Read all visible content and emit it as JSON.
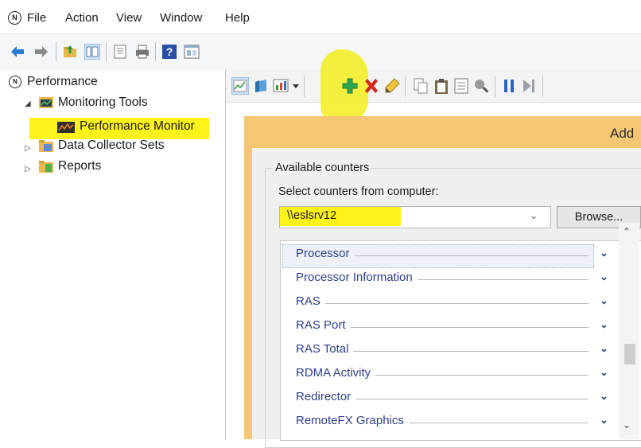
{
  "menubar": {
    "items": [
      "File",
      "Action",
      "View",
      "Window",
      "Help"
    ]
  },
  "toolbar": {
    "icons": [
      "back-arrow-icon",
      "forward-arrow-icon",
      "up-folder-icon",
      "show-hide-tree-icon",
      "properties-icon",
      "print-icon",
      "help-icon",
      "mmc-panel-icon"
    ]
  },
  "tree": {
    "root": "Performance",
    "items": [
      {
        "label": "Monitoring Tools",
        "level": 1,
        "expanded": true
      },
      {
        "label": "Performance Monitor",
        "level": 2,
        "selected": true
      },
      {
        "label": "Data Collector Sets",
        "level": 1,
        "expanded": false
      },
      {
        "label": "Reports",
        "level": 1,
        "expanded": false
      }
    ]
  },
  "pane_toolbar": {
    "icons": [
      "view-graph-icon",
      "freeze-display-icon",
      "change-graph-type-icon",
      "dropdown-arrow-icon",
      "add-counter-icon",
      "delete-counter-icon",
      "highlight-icon",
      "copy-properties-icon",
      "paste-counter-list-icon",
      "properties-icon",
      "zoom-icon",
      "pause-icon",
      "update-data-icon"
    ]
  },
  "dialog": {
    "title": "Add",
    "group_label": "Available counters",
    "select_label": "Select counters from computer:",
    "computer": "\\\\eslsrv12",
    "browse_label": "Browse...",
    "counters": [
      "Processor",
      "Processor Information",
      "RAS",
      "RAS Port",
      "RAS Total",
      "RDMA Activity",
      "Redirector",
      "RemoteFX Graphics"
    ],
    "selected_counter": "Processor"
  },
  "colors": {
    "highlight": "#fdf21a",
    "dialog_frame": "#f5c774",
    "counter_text": "#2c3e8c",
    "add_icon": "#2fa84f",
    "delete_icon": "#d9261c"
  }
}
